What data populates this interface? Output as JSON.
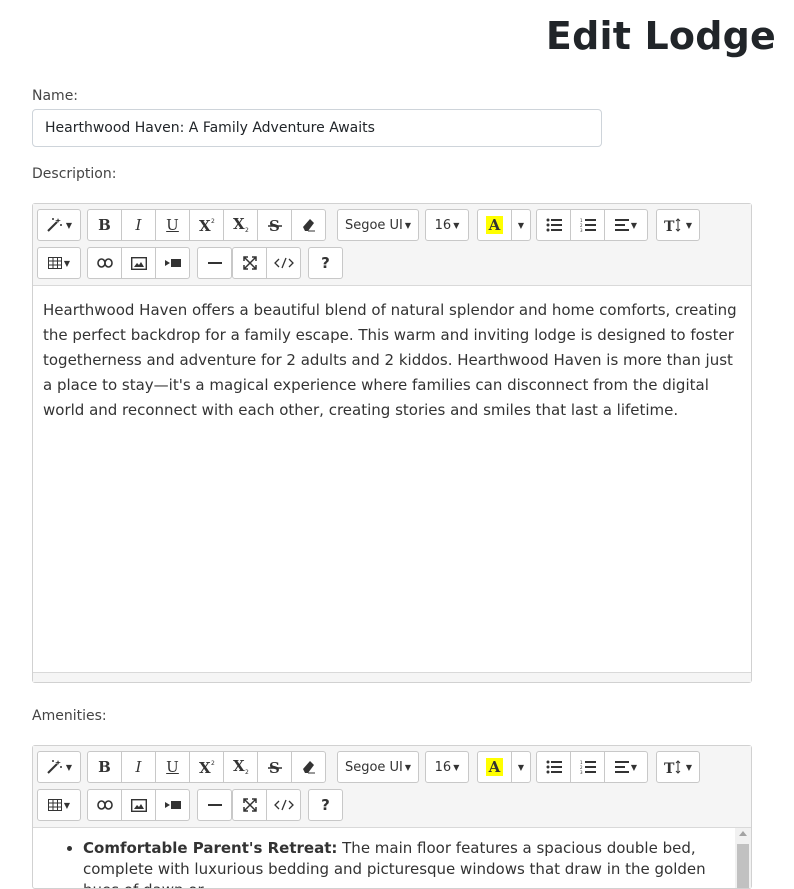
{
  "page": {
    "title": "Edit Lodge"
  },
  "name_field": {
    "label": "Name:",
    "value": "Hearthwood Haven: A Family Adventure Awaits"
  },
  "description": {
    "label": "Description:",
    "text": "Hearthwood Haven offers a beautiful blend of natural splendor and home comforts, creating the perfect backdrop for a family escape. This warm and inviting lodge is designed to foster togetherness and adventure for 2 adults and 2 kiddos. Hearthwood Haven is more than just a place to stay—it's a magical experience where families can disconnect from the digital world and reconnect with each other, creating stories and smiles that last a lifetime."
  },
  "amenities": {
    "label": "Amenities:",
    "items": [
      {
        "title": "Comfortable Parent's Retreat:",
        "text": " The main floor features a spacious double bed, complete with luxurious bedding and picturesque windows that draw in the golden hues of dawn or"
      }
    ]
  },
  "toolbar": {
    "font_name": "Segoe UI",
    "font_size": "16",
    "bold": "B",
    "italic": "I",
    "underline": "U",
    "highlight_letter": "A",
    "help": "?",
    "highlight_color": "#ffff00",
    "icons": [
      "magic-wand-icon",
      "bold-icon",
      "italic-icon",
      "underline-icon",
      "superscript-icon",
      "subscript-icon",
      "strikethrough-icon",
      "eraser-icon",
      "font-family-dropdown",
      "font-size-dropdown",
      "highlight-icon",
      "unordered-list-icon",
      "ordered-list-icon",
      "paragraph-align-icon",
      "line-height-icon",
      "table-icon",
      "link-icon",
      "picture-icon",
      "video-icon",
      "horizontal-rule-icon",
      "fullscreen-icon",
      "code-view-icon",
      "help-icon"
    ]
  }
}
